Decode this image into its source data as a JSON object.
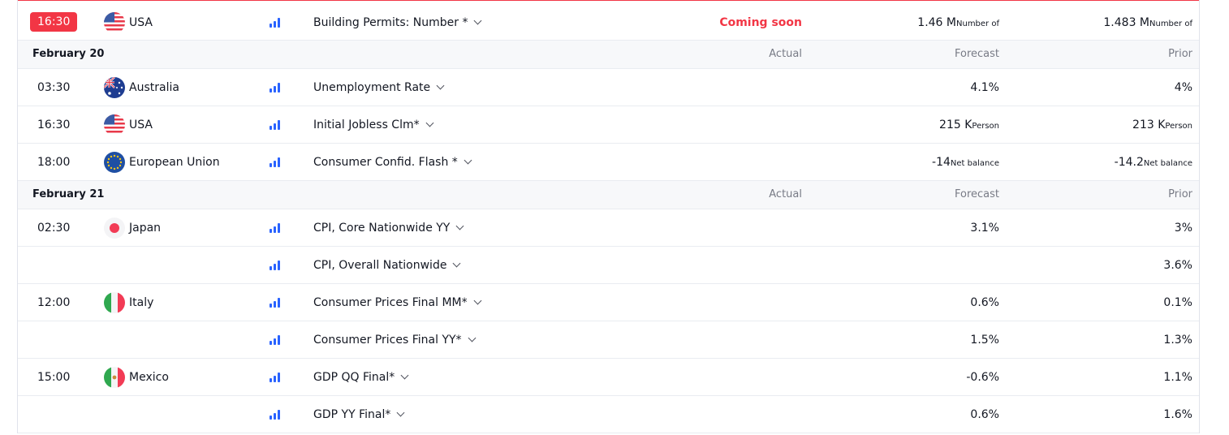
{
  "column_headers": {
    "actual": "Actual",
    "forecast": "Forecast",
    "prior": "Prior"
  },
  "top_row": {
    "time": "16:30",
    "country": "USA",
    "event": "Building Permits: Number *",
    "actual": "Coming soon",
    "forecast": "1.46 M",
    "forecast_unit": "Number of",
    "prior": "1.483 M",
    "prior_unit": "Number of"
  },
  "groups": [
    {
      "date": "February 20",
      "rows": [
        {
          "time": "03:30",
          "country": "Australia",
          "event": "Unemployment Rate",
          "forecast": "4.1%",
          "forecast_unit": "",
          "prior": "4%",
          "prior_unit": ""
        },
        {
          "time": "16:30",
          "country": "USA",
          "event": "Initial Jobless Clm*",
          "forecast": "215 K",
          "forecast_unit": "Person",
          "prior": "213 K",
          "prior_unit": "Person"
        },
        {
          "time": "18:00",
          "country": "European Union",
          "event": "Consumer Confid. Flash *",
          "forecast": "-14",
          "forecast_unit": "Net balance",
          "prior": "-14.2",
          "prior_unit": "Net balance"
        }
      ]
    },
    {
      "date": "February 21",
      "rows": [
        {
          "time": "02:30",
          "country": "Japan",
          "event": "CPI, Core Nationwide YY",
          "forecast": "3.1%",
          "forecast_unit": "",
          "prior": "3%",
          "prior_unit": ""
        },
        {
          "time": "",
          "country": "",
          "event": "CPI, Overall Nationwide",
          "forecast": "",
          "forecast_unit": "",
          "prior": "3.6%",
          "prior_unit": ""
        },
        {
          "time": "12:00",
          "country": "Italy",
          "event": "Consumer Prices Final MM*",
          "forecast": "0.6%",
          "forecast_unit": "",
          "prior": "0.1%",
          "prior_unit": ""
        },
        {
          "time": "",
          "country": "",
          "event": "Consumer Prices Final YY*",
          "forecast": "1.5%",
          "forecast_unit": "",
          "prior": "1.3%",
          "prior_unit": ""
        },
        {
          "time": "15:00",
          "country": "Mexico",
          "event": "GDP QQ Final*",
          "forecast": "-0.6%",
          "forecast_unit": "",
          "prior": "1.1%",
          "prior_unit": ""
        },
        {
          "time": "",
          "country": "",
          "event": "GDP YY Final*",
          "forecast": "0.6%",
          "forecast_unit": "",
          "prior": "1.6%",
          "prior_unit": ""
        }
      ]
    }
  ],
  "colors": {
    "accent_red": "#f23645",
    "bar_blue": "#2962ff",
    "muted": "#787b86"
  },
  "icons": [
    "flag-usa-icon",
    "flag-australia-icon",
    "flag-eu-icon",
    "flag-japan-icon",
    "flag-italy-icon",
    "flag-mexico-icon",
    "importance-bars-icon",
    "chevron-down-icon"
  ]
}
